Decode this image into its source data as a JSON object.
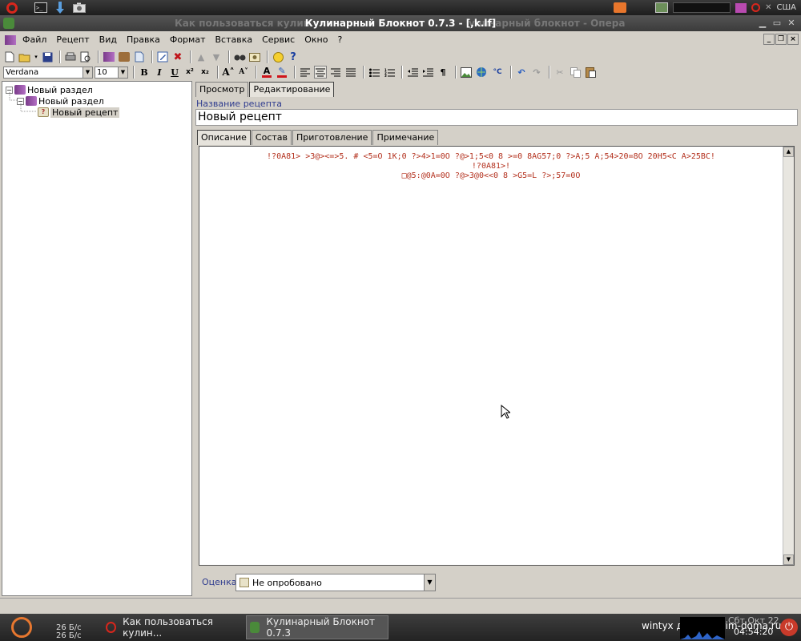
{
  "top_panel": {
    "locale": "США"
  },
  "window": {
    "title": "Кулинарный Блокнот 0.7.3 - [,k.lf]",
    "ghost_left": "Как пользоваться кулин",
    "ghost_right": "улинарный блокнот - Опера"
  },
  "menu": [
    "Файл",
    "Рецепт",
    "Вид",
    "Правка",
    "Формат",
    "Вставка",
    "Сервис",
    "Окно",
    "?"
  ],
  "toolbar": {
    "font_name": "Verdana",
    "font_size": "10"
  },
  "tree": {
    "root": "Новый раздел",
    "child": "Новый раздел",
    "leaf": "Новый рецепт"
  },
  "tabs": {
    "view": "Просмотр",
    "edit": "Редактирование"
  },
  "recipe": {
    "name_label": "Название рецепта",
    "name_value": "Новый рецепт"
  },
  "inner_tabs": [
    "Описание",
    "Состав",
    "Приготовление",
    "Примечание"
  ],
  "editor": {
    "line1": "!?0A81> >3@><=>5. # <5=O 1K;0 ?>4>1=0O ?@>1;5<0 8 >=0 8AG57;0 ?>A;5 A;54>20=8O 20H5<C A>25BC!",
    "line2": "!?0A81>!",
    "line3": "□@5:@0A=0O ?@>3@0<<0 8 >G5=L ?>;57=0O"
  },
  "rating": {
    "label": "Оценка",
    "value": "Не опробовано"
  },
  "taskbar": {
    "net_up": "26 Б/с",
    "net_down": "26 Б/с",
    "task1": "Как пользоваться кулин...",
    "task2": "Кулинарный Блокнот 0.7.3",
    "tray_user": "wintyx для gotovim-doma.ru",
    "date": "Сбт Окт 22",
    "time": "04:54:20"
  },
  "colors": {
    "label_blue": "#2f3c8f",
    "editor_text": "#b3301d",
    "ubuntu_orange": "#e7772f"
  }
}
